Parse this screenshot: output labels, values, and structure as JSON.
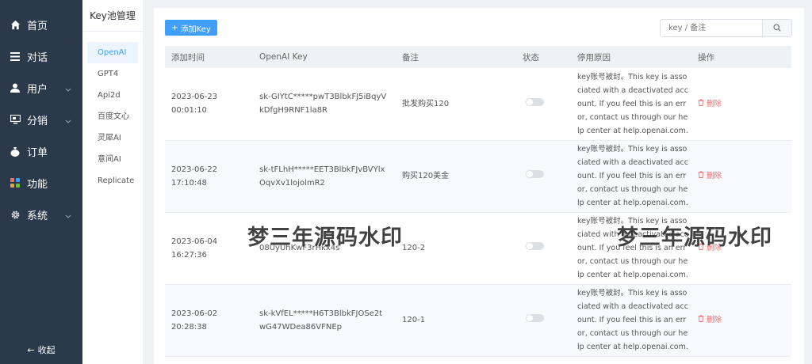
{
  "sidebar": {
    "items": [
      {
        "label": "首页",
        "icon": "home-icon",
        "chevron": false
      },
      {
        "label": "对话",
        "icon": "list-icon",
        "chevron": false
      },
      {
        "label": "用户",
        "icon": "user-icon",
        "chevron": true
      },
      {
        "label": "分销",
        "icon": "share-icon",
        "chevron": true
      },
      {
        "label": "订单",
        "icon": "bag-icon",
        "chevron": false
      },
      {
        "label": "功能",
        "icon": "apps-icon",
        "chevron": false
      },
      {
        "label": "系统",
        "icon": "gear-icon",
        "chevron": true
      }
    ],
    "collapse_label": "收起"
  },
  "submenu": {
    "title": "Key池管理",
    "items": [
      "OpenAI",
      "GPT4",
      "Api2d",
      "百度文心",
      "灵犀AI",
      "意间AI",
      "Replicate"
    ],
    "active": "OpenAI"
  },
  "toolbar": {
    "add_label": "添加Key",
    "search_placeholder": "key / 备注"
  },
  "table": {
    "columns": [
      "添加时间",
      "OpenAI Key",
      "备注",
      "状态",
      "停用原因",
      "操作"
    ],
    "rows": [
      {
        "time": "2023-06-23 00:01:10",
        "key": "sk-GIYtC*****pwT3BlbkFJ5iBqyVkDfgH9RNF1la8R",
        "note": "批发购买120",
        "reason": "key账号被封。This key is associated with a deactivated account. If you feel this is an error, contact us through our help center at help.openai.com.",
        "action": "删除"
      },
      {
        "time": "2023-06-22 17:10:48",
        "key": "sk-tFLhH*****EET3BlbkFJvBVYlxOqvXv1lojolmR2",
        "note": "购买120美金",
        "reason": "key账号被封。This key is associated with a deactivated account. If you feel this is an error, contact us through our help center at help.openai.com.",
        "action": "删除"
      },
      {
        "time": "2023-06-04 16:27:36",
        "key": "08UyUhKwF3rHkx4s",
        "note": "120-2",
        "reason": "key账号被封。This key is associated with a deactivated account. If you feel this is an error, contact us through our help center at help.openai.com.",
        "action": "删除"
      },
      {
        "time": "2023-06-02 20:28:38",
        "key": "sk-kVfEL*****H6T3BlbkFJOSe2twG47WDea86VFNEp",
        "note": "120-1",
        "reason": "key账号被封。This key is associated with a deactivated account. If you feel this is an error, contact us through our help center at help.openai.com.",
        "action": "删除"
      }
    ]
  },
  "watermark": {
    "text": "梦三年源码水印"
  },
  "colors": {
    "primary": "#409eff",
    "sidebar": "#2b3a4b",
    "danger": "#f56c6c"
  }
}
